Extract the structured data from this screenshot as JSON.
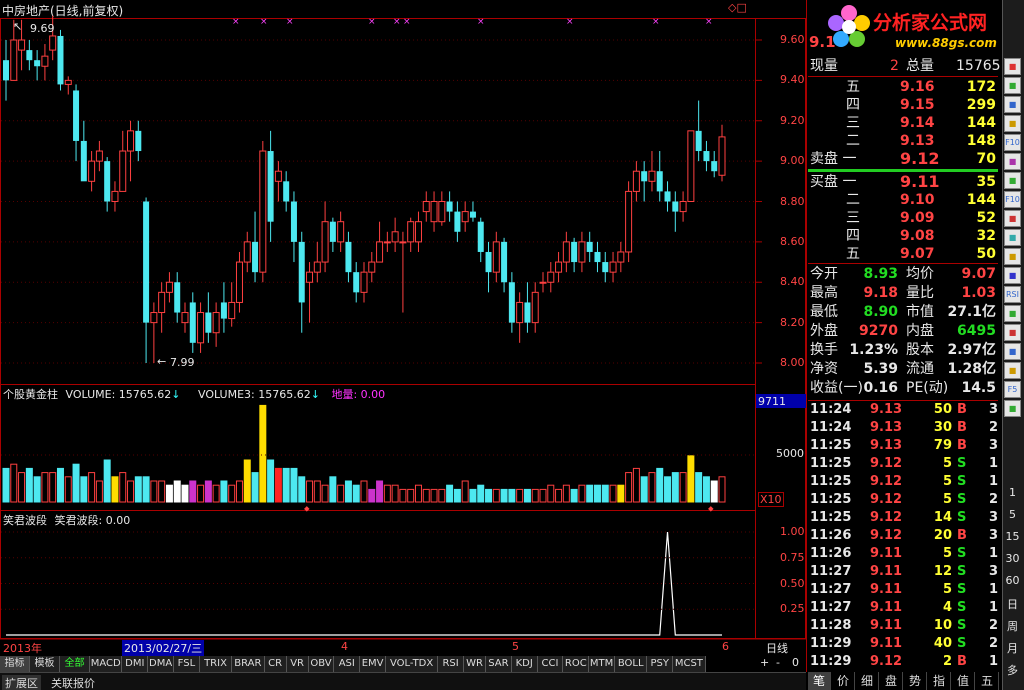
{
  "chart_title": "中房地产(日线,前复权)",
  "price_labels": {
    "high": "9.69",
    "low": "7.99"
  },
  "price_axis_ticks": [
    "9.60",
    "9.40",
    "9.20",
    "9.00",
    "8.80",
    "8.60",
    "8.40",
    "8.20",
    "8.00"
  ],
  "volume_header": {
    "name": "个股黄金柱",
    "v1": "VOLUME: 15765.62",
    "v3": "VOLUME3: 15765.62",
    "diliang": "地量: 0.00"
  },
  "volume_axis": {
    "top": "9711",
    "mid": "5000",
    "unit": "X10"
  },
  "wave_header": {
    "name": "笑君波段",
    "value": "笑君波段: 0.00"
  },
  "wave_axis_ticks": [
    "1.00",
    "0.75",
    "0.50",
    "0.25"
  ],
  "date_axis": {
    "year": "2013年",
    "cursor": "2013/02/27/三",
    "m4": "4",
    "m5": "5",
    "m6": "6",
    "period": "日线"
  },
  "indicator_tabs": [
    "指标",
    "模板",
    "全部",
    "MACD",
    "DMI",
    "DMA",
    "FSL",
    "TRIX",
    "BRAR",
    "CR",
    "VR",
    "OBV",
    "ASI",
    "EMV",
    "VOL-TDX",
    "RSI",
    "WR",
    "SAR",
    "KDJ",
    "CCI",
    "ROC",
    "MTM",
    "BOLL",
    "PSY",
    "MCST"
  ],
  "bottom_left_tabs": [
    "扩展区",
    "关联报价"
  ],
  "zoom_buttons": [
    "+",
    "-",
    "0"
  ],
  "logo": {
    "text": "分析家公式网",
    "url": "www.88gs.com"
  },
  "quote": {
    "price_short": "9.1",
    "xianliang_label": "现量",
    "xianliang": "2",
    "zongliang_label": "总量",
    "zongliang": "15765",
    "sell": [
      {
        "label": "五",
        "price": "9.16",
        "vol": "172"
      },
      {
        "label": "四",
        "price": "9.15",
        "vol": "299"
      },
      {
        "label": "三",
        "price": "9.14",
        "vol": "144"
      },
      {
        "label": "二",
        "price": "9.13",
        "vol": "148"
      },
      {
        "label": "卖盘 一",
        "price": "9.12",
        "vol": "70"
      }
    ],
    "buy": [
      {
        "label": "买盘 一",
        "price": "9.11",
        "vol": "35"
      },
      {
        "label": "二",
        "price": "9.10",
        "vol": "144"
      },
      {
        "label": "三",
        "price": "9.09",
        "vol": "52"
      },
      {
        "label": "四",
        "price": "9.08",
        "vol": "32"
      },
      {
        "label": "五",
        "price": "9.07",
        "vol": "50"
      }
    ],
    "stats": [
      {
        "l1": "今开",
        "v1": "8.93",
        "l2": "均价",
        "v2": "9.07"
      },
      {
        "l1": "最高",
        "v1": "9.18",
        "l2": "量比",
        "v2": "1.03"
      },
      {
        "l1": "最低",
        "v1": "8.90",
        "l2": "市值",
        "v2": "27.1亿"
      },
      {
        "l1": "外盘",
        "v1": "9270",
        "l2": "内盘",
        "v2": "6495"
      },
      {
        "l1": "换手",
        "v1": "1.23%",
        "l2": "股本",
        "v2": "2.97亿"
      },
      {
        "l1": "净资",
        "v1": "5.39",
        "l2": "流通",
        "v2": "1.28亿"
      },
      {
        "l1": "收益(一)",
        "v1": "0.16",
        "l2": "PE(动)",
        "v2": "14.5"
      }
    ]
  },
  "ticks": [
    {
      "t": "11:24",
      "p": "9.13",
      "v": "50",
      "s": "B",
      "n": "3"
    },
    {
      "t": "11:24",
      "p": "9.13",
      "v": "30",
      "s": "B",
      "n": "2"
    },
    {
      "t": "11:25",
      "p": "9.13",
      "v": "79",
      "s": "B",
      "n": "3"
    },
    {
      "t": "11:25",
      "p": "9.12",
      "v": "5",
      "s": "S",
      "n": "1"
    },
    {
      "t": "11:25",
      "p": "9.12",
      "v": "5",
      "s": "S",
      "n": "1"
    },
    {
      "t": "11:25",
      "p": "9.12",
      "v": "5",
      "s": "S",
      "n": "2"
    },
    {
      "t": "11:25",
      "p": "9.12",
      "v": "14",
      "s": "S",
      "n": "3"
    },
    {
      "t": "11:26",
      "p": "9.12",
      "v": "20",
      "s": "B",
      "n": "3"
    },
    {
      "t": "11:26",
      "p": "9.11",
      "v": "5",
      "s": "S",
      "n": "1"
    },
    {
      "t": "11:27",
      "p": "9.11",
      "v": "12",
      "s": "S",
      "n": "3"
    },
    {
      "t": "11:27",
      "p": "9.11",
      "v": "5",
      "s": "S",
      "n": "1"
    },
    {
      "t": "11:27",
      "p": "9.11",
      "v": "4",
      "s": "S",
      "n": "1"
    },
    {
      "t": "11:28",
      "p": "9.11",
      "v": "10",
      "s": "S",
      "n": "2"
    },
    {
      "t": "11:29",
      "p": "9.11",
      "v": "40",
      "s": "S",
      "n": "2"
    },
    {
      "t": "11:29",
      "p": "9.12",
      "v": "2",
      "s": "B",
      "n": "1"
    }
  ],
  "bottom_right_tabs": [
    "笔",
    "价",
    "细",
    "盘",
    "势",
    "指",
    "值",
    "五"
  ],
  "side_icons": [
    "",
    "",
    "",
    "",
    "F10",
    "",
    "",
    "F10",
    "",
    "",
    "",
    "",
    "RSI",
    "",
    "",
    "",
    "",
    "F5",
    ""
  ],
  "period_buttons": [
    "1",
    "5",
    "15",
    "30",
    "60",
    "日",
    "周",
    "月",
    "多"
  ],
  "colors": {
    "up": "#ff4040",
    "down": "#4de8f0",
    "gold": "#ffdd00",
    "frame": "#aa0000"
  },
  "chart_data": {
    "type": "candlestick",
    "ylim": [
      7.9,
      9.72
    ],
    "ohlc": [
      [
        9.5,
        9.6,
        9.3,
        9.4,
        0
      ],
      [
        9.4,
        9.7,
        9.4,
        9.6,
        1
      ],
      [
        9.6,
        9.7,
        9.45,
        9.55,
        1
      ],
      [
        9.55,
        9.6,
        9.45,
        9.5,
        0
      ],
      [
        9.5,
        9.55,
        9.4,
        9.47,
        0
      ],
      [
        9.47,
        9.58,
        9.4,
        9.52,
        1
      ],
      [
        9.55,
        9.72,
        9.5,
        9.62,
        1
      ],
      [
        9.62,
        9.65,
        9.35,
        9.38,
        0
      ],
      [
        9.38,
        9.42,
        9.33,
        9.4,
        1
      ],
      [
        9.35,
        9.38,
        9.0,
        9.1,
        0
      ],
      [
        9.1,
        9.2,
        8.95,
        8.9,
        0
      ],
      [
        8.9,
        9.05,
        8.85,
        9.0,
        1
      ],
      [
        9.0,
        9.1,
        8.95,
        9.05,
        1
      ],
      [
        9.0,
        9.02,
        8.75,
        8.8,
        0
      ],
      [
        8.8,
        8.9,
        8.75,
        8.85,
        1
      ],
      [
        8.85,
        9.15,
        8.85,
        9.05,
        1
      ],
      [
        9.05,
        9.2,
        8.9,
        9.15,
        1
      ],
      [
        9.15,
        9.2,
        9.0,
        9.05,
        0
      ],
      [
        8.8,
        8.82,
        8.0,
        8.2,
        0
      ],
      [
        8.2,
        8.3,
        8.0,
        8.25,
        1
      ],
      [
        8.25,
        8.4,
        8.15,
        8.35,
        1
      ],
      [
        8.35,
        8.45,
        8.3,
        8.4,
        1
      ],
      [
        8.4,
        8.45,
        8.2,
        8.25,
        0
      ],
      [
        8.25,
        8.3,
        8.15,
        8.2,
        1
      ],
      [
        8.3,
        8.35,
        8.05,
        8.1,
        0
      ],
      [
        8.1,
        8.3,
        8.05,
        8.25,
        1
      ],
      [
        8.25,
        8.35,
        8.1,
        8.15,
        0
      ],
      [
        8.15,
        8.3,
        8.08,
        8.25,
        1
      ],
      [
        8.3,
        8.4,
        8.15,
        8.22,
        0
      ],
      [
        8.22,
        8.4,
        8.18,
        8.3,
        1
      ],
      [
        8.3,
        8.55,
        8.25,
        8.5,
        1
      ],
      [
        8.5,
        8.65,
        8.45,
        8.6,
        1
      ],
      [
        8.6,
        8.75,
        8.4,
        8.45,
        0
      ],
      [
        8.45,
        9.1,
        8.4,
        9.05,
        1
      ],
      [
        9.05,
        9.15,
        8.6,
        8.7,
        0
      ],
      [
        8.9,
        9.0,
        8.8,
        8.95,
        1
      ],
      [
        8.9,
        8.95,
        8.75,
        8.8,
        0
      ],
      [
        8.8,
        8.85,
        8.5,
        8.6,
        0
      ],
      [
        8.6,
        8.65,
        8.15,
        8.3,
        0
      ],
      [
        8.4,
        8.5,
        8.2,
        8.45,
        1
      ],
      [
        8.45,
        8.6,
        8.4,
        8.5,
        1
      ],
      [
        8.5,
        8.8,
        8.45,
        8.7,
        1
      ],
      [
        8.7,
        8.72,
        8.55,
        8.6,
        0
      ],
      [
        8.6,
        8.75,
        8.55,
        8.7,
        1
      ],
      [
        8.6,
        8.65,
        8.4,
        8.45,
        0
      ],
      [
        8.45,
        8.5,
        8.3,
        8.35,
        0
      ],
      [
        8.35,
        8.5,
        8.3,
        8.45,
        1
      ],
      [
        8.45,
        8.55,
        8.4,
        8.5,
        1
      ],
      [
        8.5,
        8.7,
        8.5,
        8.6,
        1
      ],
      [
        8.6,
        8.65,
        8.55,
        8.6,
        1
      ],
      [
        8.6,
        8.72,
        8.55,
        8.65,
        1
      ],
      [
        8.6,
        8.65,
        8.25,
        8.6,
        1
      ],
      [
        8.6,
        8.72,
        8.55,
        8.7,
        1
      ],
      [
        8.6,
        8.75,
        8.55,
        8.7,
        1
      ],
      [
        8.75,
        8.85,
        8.7,
        8.8,
        1
      ],
      [
        8.8,
        8.85,
        8.65,
        8.7,
        1
      ],
      [
        8.7,
        8.85,
        8.68,
        8.8,
        1
      ],
      [
        8.8,
        8.85,
        8.7,
        8.75,
        0
      ],
      [
        8.75,
        8.8,
        8.6,
        8.65,
        0
      ],
      [
        8.7,
        8.8,
        8.65,
        8.75,
        1
      ],
      [
        8.75,
        8.8,
        8.7,
        8.72,
        0
      ],
      [
        8.7,
        8.72,
        8.5,
        8.55,
        0
      ],
      [
        8.55,
        8.6,
        8.35,
        8.45,
        0
      ],
      [
        8.45,
        8.65,
        8.4,
        8.6,
        1
      ],
      [
        8.6,
        8.62,
        8.35,
        8.4,
        0
      ],
      [
        8.4,
        8.45,
        8.15,
        8.2,
        0
      ],
      [
        8.2,
        8.35,
        8.1,
        8.3,
        1
      ],
      [
        8.3,
        8.4,
        8.15,
        8.2,
        0
      ],
      [
        8.2,
        8.4,
        8.15,
        8.35,
        1
      ],
      [
        8.4,
        8.45,
        8.35,
        8.4,
        1
      ],
      [
        8.4,
        8.5,
        8.35,
        8.45,
        1
      ],
      [
        8.45,
        8.55,
        8.4,
        8.5,
        1
      ],
      [
        8.5,
        8.65,
        8.45,
        8.6,
        1
      ],
      [
        8.6,
        8.62,
        8.45,
        8.5,
        0
      ],
      [
        8.5,
        8.65,
        8.45,
        8.6,
        1
      ],
      [
        8.6,
        8.65,
        8.5,
        8.55,
        0
      ],
      [
        8.55,
        8.6,
        8.45,
        8.5,
        0
      ],
      [
        8.5,
        8.55,
        8.4,
        8.45,
        0
      ],
      [
        8.45,
        8.55,
        8.4,
        8.5,
        1
      ],
      [
        8.5,
        8.6,
        8.45,
        8.55,
        1
      ],
      [
        8.55,
        8.9,
        8.5,
        8.85,
        1
      ],
      [
        8.85,
        9.0,
        8.8,
        8.95,
        1
      ],
      [
        8.95,
        9.0,
        8.8,
        8.9,
        0
      ],
      [
        8.9,
        9.05,
        8.85,
        8.95,
        1
      ],
      [
        8.95,
        9.05,
        8.8,
        8.85,
        0
      ],
      [
        8.85,
        8.9,
        8.75,
        8.8,
        0
      ],
      [
        8.8,
        8.85,
        8.65,
        8.75,
        0
      ],
      [
        8.75,
        8.85,
        8.7,
        8.8,
        1
      ],
      [
        8.8,
        9.15,
        8.8,
        9.15,
        1
      ],
      [
        9.15,
        9.3,
        9.0,
        9.05,
        0
      ],
      [
        9.05,
        9.1,
        8.95,
        9.0,
        0
      ],
      [
        9.0,
        9.05,
        8.92,
        8.95,
        0
      ],
      [
        8.93,
        9.18,
        8.9,
        9.12,
        1
      ]
    ],
    "volume": [
      8,
      9,
      7,
      8,
      6,
      7,
      7,
      8,
      6,
      9,
      6,
      7,
      5,
      10,
      6,
      7,
      5,
      6,
      6,
      5,
      5,
      4,
      5,
      4,
      5,
      4,
      5,
      4,
      5,
      4,
      5,
      10,
      7,
      23,
      10,
      8,
      8,
      8,
      6,
      5,
      5,
      4,
      6,
      4,
      5,
      4,
      5,
      3,
      5,
      4,
      4,
      3,
      3,
      4,
      3,
      3,
      3,
      4,
      3,
      5,
      3,
      4,
      3,
      3,
      3,
      3,
      3,
      3,
      3,
      3,
      4,
      3,
      4,
      3,
      4,
      4,
      4,
      4,
      4,
      4,
      7,
      8,
      6,
      7,
      8,
      6,
      7,
      7,
      11,
      7,
      6,
      5,
      6
    ],
    "wave_peak_index": 85,
    "wave_ylim": [
      0,
      1.1
    ],
    "wave_ticks": [
      1.0,
      0.75,
      0.5,
      0.25
    ]
  }
}
